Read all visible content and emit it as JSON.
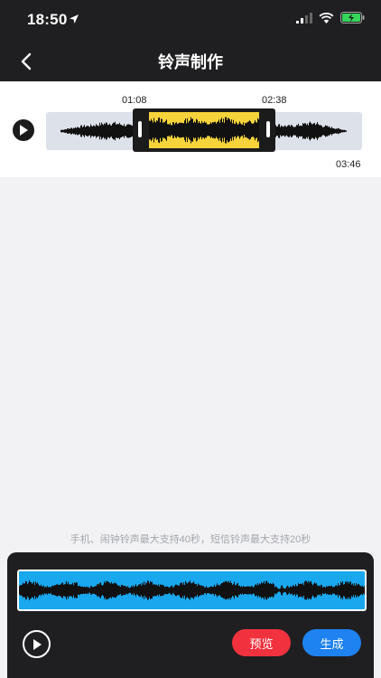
{
  "status_bar": {
    "time": "18:50",
    "icons": [
      "location-arrow-icon",
      "signal-icon",
      "wifi-icon",
      "battery-charging-icon"
    ]
  },
  "nav": {
    "title": "铃声制作",
    "back_icon": "chevron-left-icon"
  },
  "editor": {
    "start_time": "01:08",
    "end_time": "02:38",
    "total_time": "03:46",
    "play_icon": "play-icon"
  },
  "hint": "手机、闹钟铃声最大支持40秒，短信铃声最大支持20秒",
  "controls": {
    "preview_label": "预览",
    "generate_label": "生成",
    "play_icon": "play-icon"
  },
  "colors": {
    "topbar": "#1f1f21",
    "selection": "#f6d33b",
    "blue_wave_bg": "#19a7ee",
    "preview_btn": "#f1323e",
    "generate_btn": "#1e82f1"
  }
}
